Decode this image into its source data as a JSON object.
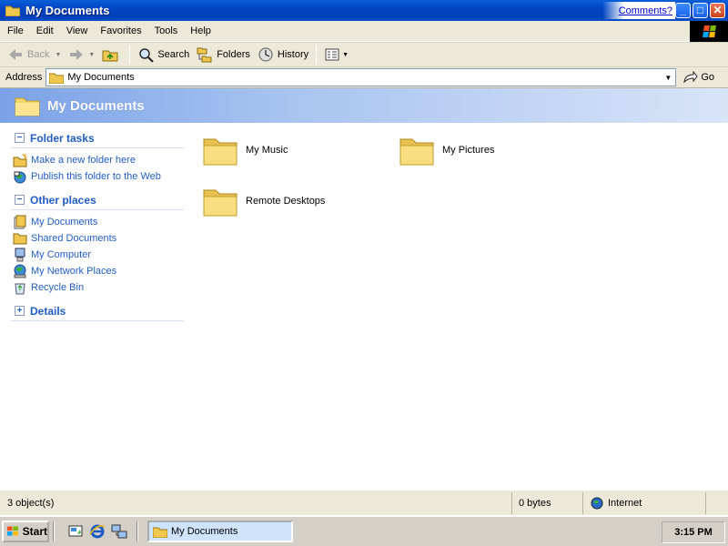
{
  "window": {
    "title": "My Documents",
    "comments_link": "Comments?",
    "min_glyph": "_",
    "max_glyph": "□",
    "close_glyph": "✕"
  },
  "menu": [
    "File",
    "Edit",
    "View",
    "Favorites",
    "Tools",
    "Help"
  ],
  "toolbar": {
    "back": "Back",
    "search": "Search",
    "folders": "Folders",
    "history": "History"
  },
  "address": {
    "label": "Address",
    "value": "My Documents",
    "go": "Go"
  },
  "banner": {
    "title": "My Documents"
  },
  "sections": {
    "folder_tasks": {
      "title": "Folder tasks",
      "toggle": "−",
      "items": [
        "Make a new folder here",
        "Publish this folder to the Web"
      ]
    },
    "other_places": {
      "title": "Other places",
      "toggle": "−",
      "items": [
        "My Documents",
        "Shared Documents",
        "My Computer",
        "My Network Places",
        "Recycle Bin"
      ]
    },
    "details": {
      "title": "Details",
      "toggle": "+"
    }
  },
  "folders": [
    "My Music",
    "My Pictures",
    "Remote Desktops"
  ],
  "status": {
    "objects": "3 object(s)",
    "size": "0 bytes",
    "zone": "Internet"
  },
  "taskbar": {
    "start": "Start",
    "window_button": "My Documents",
    "clock": "3:15 PM"
  },
  "colors": {
    "titlebar": "#0045c4",
    "link_blue": "#215dc6",
    "folder_yellow": "#f5d66a"
  }
}
